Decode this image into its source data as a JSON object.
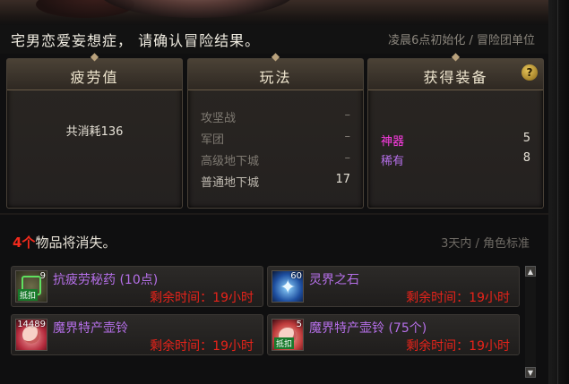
{
  "header": {
    "title": "宅男恋爱妄想症， 请确认冒险结果。",
    "reset_info": "凌晨6点初始化 / 冒险团单位"
  },
  "fatigue_panel": {
    "title": "疲劳值",
    "summary": "共消耗136"
  },
  "mode_panel": {
    "title": "玩法",
    "rows": [
      {
        "name": "攻坚战",
        "value": "–"
      },
      {
        "name": "军团",
        "value": "–"
      },
      {
        "name": "高级地下城",
        "value": "–"
      },
      {
        "name": "普通地下城",
        "value": "17"
      }
    ]
  },
  "equip_panel": {
    "title": "获得装备",
    "help": "?",
    "rows": [
      {
        "name": "神器",
        "value": "5",
        "color": "#ff3ce6"
      },
      {
        "name": "稀有",
        "value": "8",
        "color": "#b56fe8"
      }
    ]
  },
  "vanish": {
    "count": "4个",
    "text": "物品将消失。",
    "note": "3天内 / 角色标准"
  },
  "items": [
    {
      "name": "抗疲劳秘药 (10点)",
      "time": "剩余时间：19小时",
      "qty": "9",
      "tag": "抵扣",
      "icon": "fatigue-potion-icon"
    },
    {
      "name": "灵界之石",
      "time": "剩余时间：19小时",
      "qty": "60",
      "icon": "soul-stone-icon"
    },
    {
      "name": "魔界特产壶铃",
      "time": "剩余时间：19小时",
      "qty": "14489",
      "icon": "pot-bell-icon"
    },
    {
      "name": "魔界特产壶铃 (75个)",
      "time": "剩余时间：19小时",
      "qty": "5",
      "tag": "抵扣",
      "icon": "pot-bell-icon"
    }
  ],
  "scroll": {
    "up": "▲",
    "down": "▼"
  }
}
